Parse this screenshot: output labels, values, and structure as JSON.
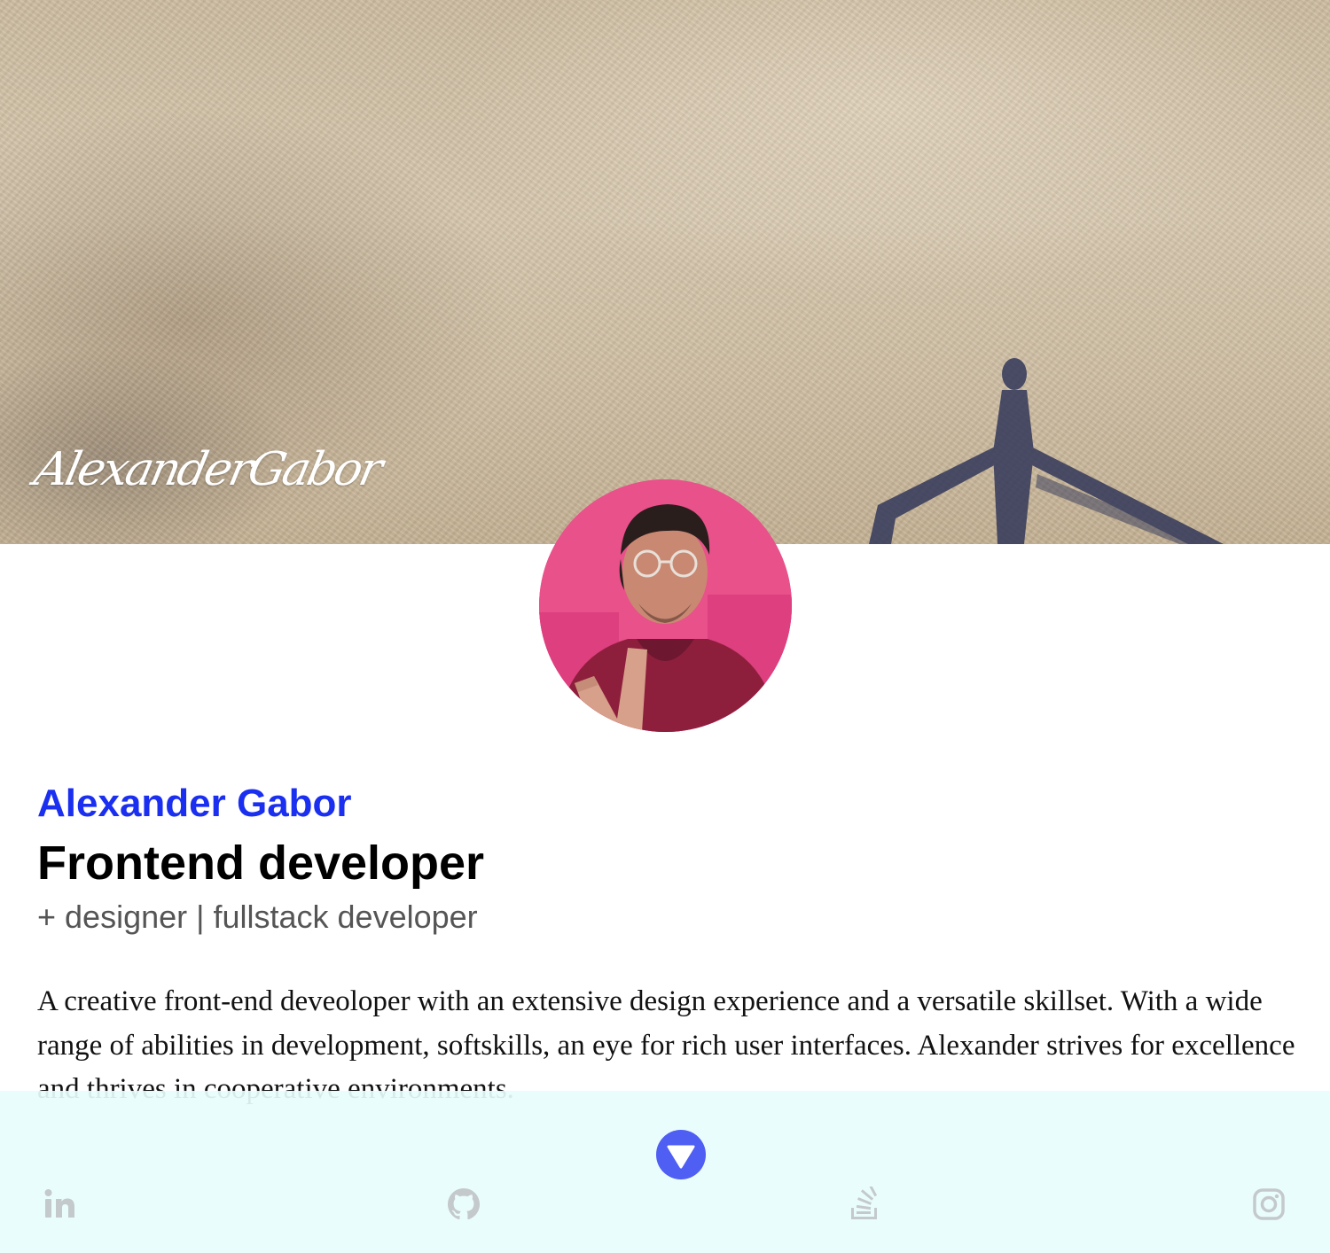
{
  "hero": {
    "signature": "AlexanderGabor"
  },
  "profile": {
    "name": "Alexander Gabor",
    "title": "Frontend developer",
    "subtitle": "+ designer | fullstack developer",
    "bio": "A creative front-end deveoloper with an extensive design experience and a versatile skillset. With a wide range of abilities in development, softskills, an eye for rich user interfaces. Alexander strives for excellence and thrives in cooperative environments."
  },
  "footer": {
    "scroll_icon": "triangle-down-icon",
    "accent_color": "#4f5ef3",
    "social": [
      {
        "icon": "linkedin-icon"
      },
      {
        "icon": "github-icon"
      },
      {
        "icon": "stackoverflow-icon"
      },
      {
        "icon": "instagram-icon"
      }
    ]
  },
  "colors": {
    "name": "#1a2ff0",
    "footer_bg": "#e8fdfd"
  }
}
